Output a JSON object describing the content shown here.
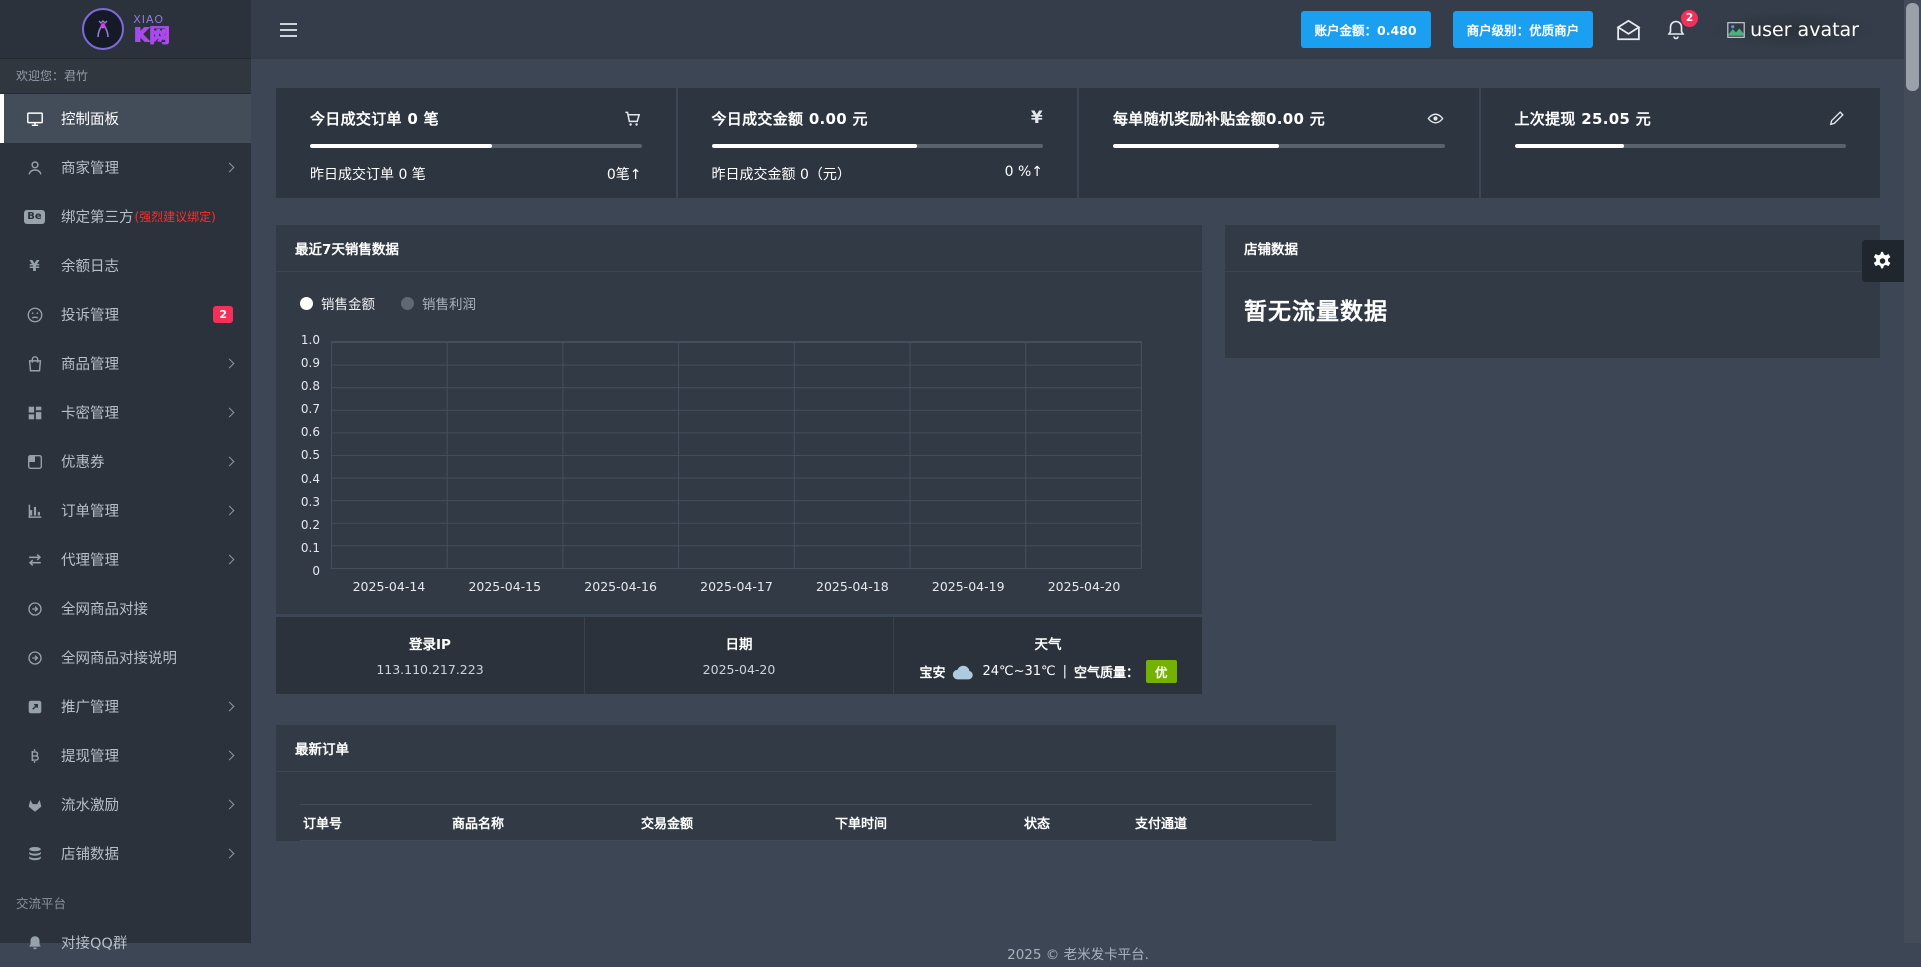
{
  "app": {
    "brand_primary": "XIAO",
    "brand_secondary": "K网",
    "footer_text": "2025 © 老米发卡平台."
  },
  "topbar": {
    "balance_button": "账户金额：0.480",
    "level_button": "商户级别：优质商户",
    "notification_count": "2",
    "avatar_alt": "user avatar"
  },
  "sidebar": {
    "welcome": "欢迎您：君竹",
    "section_label": "交流平台",
    "items": [
      {
        "label": "控制面板",
        "icon": "monitor-icon",
        "active": true
      },
      {
        "label": "商家管理",
        "icon": "user-icon",
        "expandable": true
      },
      {
        "label": "绑定第三方",
        "note": "(强烈建议绑定)",
        "icon": "behance-icon"
      },
      {
        "label": "余额日志",
        "icon": "yen-icon"
      },
      {
        "label": "投诉管理",
        "icon": "frown-icon",
        "badge": "2"
      },
      {
        "label": "商品管理",
        "icon": "shopping-bag-icon",
        "expandable": true
      },
      {
        "label": "卡密管理",
        "icon": "grid-icon",
        "expandable": true
      },
      {
        "label": "优惠券",
        "icon": "coupon-icon",
        "expandable": true
      },
      {
        "label": "订单管理",
        "icon": "bar-chart-icon",
        "expandable": true
      },
      {
        "label": "代理管理",
        "icon": "swap-icon",
        "expandable": true
      },
      {
        "label": "全网商品对接",
        "icon": "arrow-circle-icon"
      },
      {
        "label": "全网商品对接说明",
        "icon": "arrow-circle-icon"
      },
      {
        "label": "推广管理",
        "icon": "external-link-icon",
        "expandable": true
      },
      {
        "label": "提现管理",
        "icon": "bitcoin-icon",
        "expandable": true
      },
      {
        "label": "流水激励",
        "icon": "gitlab-icon",
        "expandable": true
      },
      {
        "label": "店铺数据",
        "icon": "database-icon",
        "expandable": true
      }
    ],
    "qq_group": {
      "label": "对接QQ群",
      "icon": "bell-icon"
    }
  },
  "icons": {
    "behance_text": "Be",
    "yen_text": "¥"
  },
  "cards": [
    {
      "title": "今日成交订单 0 笔",
      "icon": "cart-icon",
      "progress_pct": 55,
      "progress_style": "width:55%",
      "sub_left": "昨日成交订单 0 笔",
      "sub_right": "0笔↑"
    },
    {
      "title": "今日成交金额 0.00 元",
      "icon": "yen-icon",
      "progress_pct": 62,
      "progress_style": "width:62%",
      "sub_left": "昨日成交金额 0（元）",
      "sub_right": "0 %↑"
    },
    {
      "title": "每单随机奖励补贴金额0.00 元",
      "icon": "eye-icon",
      "progress_pct": 50,
      "progress_style": "width:50%",
      "sub_left": "",
      "sub_right": ""
    },
    {
      "title": "上次提现 25.05 元",
      "icon": "pen-icon",
      "progress_pct": 33,
      "progress_style": "width:33%",
      "sub_left": "",
      "sub_right": ""
    }
  ],
  "sales_panel": {
    "title": "最近7天销售数据",
    "legend": [
      {
        "label": "销售金额",
        "active": true
      },
      {
        "label": "销售利润",
        "active": false
      }
    ]
  },
  "chart_data": {
    "type": "line",
    "title": "最近7天销售数据",
    "x": [
      "2025-04-14",
      "2025-04-15",
      "2025-04-16",
      "2025-04-17",
      "2025-04-18",
      "2025-04-19",
      "2025-04-20"
    ],
    "series": [
      {
        "name": "销售金额",
        "values": [
          0,
          0,
          0,
          0,
          0,
          0,
          0
        ]
      },
      {
        "name": "销售利润",
        "values": [
          0,
          0,
          0,
          0,
          0,
          0,
          0
        ]
      }
    ],
    "ylim": [
      0,
      1.0
    ],
    "y_ticks": [
      "1.0",
      "0.9",
      "0.8",
      "0.7",
      "0.6",
      "0.5",
      "0.4",
      "0.3",
      "0.2",
      "0.1",
      "0"
    ],
    "grid": true,
    "legend_position": "top-left"
  },
  "info_strip": {
    "login_ip": {
      "label": "登录IP",
      "value": "113.110.217.223"
    },
    "date": {
      "label": "日期",
      "value": "2025-04-20"
    },
    "weather": {
      "label": "天气",
      "city": "宝安",
      "temp": "24℃~31℃",
      "separator": "|",
      "air_label": "空气质量：",
      "air_value": "优"
    }
  },
  "shop_panel": {
    "title": "店铺数据",
    "empty_text": "暂无流量数据"
  },
  "orders_panel": {
    "title": "最新订单",
    "columns": [
      "订单号",
      "商品名称",
      "交易金额",
      "下单时间",
      "状态",
      "支付通道"
    ],
    "rows": []
  }
}
